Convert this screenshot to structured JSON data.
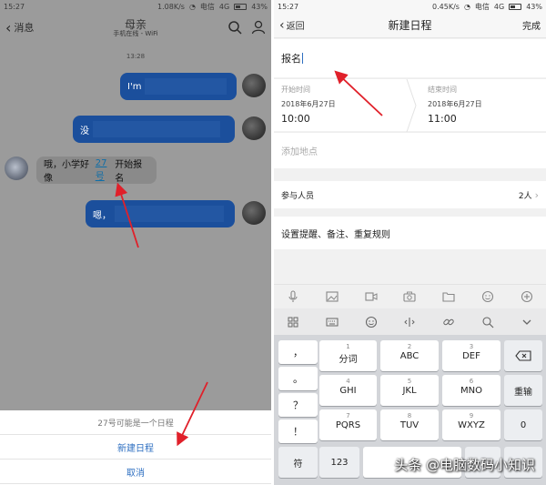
{
  "left": {
    "status": {
      "time": "15:27",
      "network": "1.08K/s",
      "carrier": "电信",
      "net_type": "4G",
      "battery": "43%"
    },
    "header": {
      "back_label": "消息",
      "contact_name": "母亲",
      "contact_sub": "手机在线 - WiFi"
    },
    "timestamp": "13:28",
    "messages": [
      {
        "side": "out",
        "text": "I'm"
      },
      {
        "side": "out",
        "text": "没"
      },
      {
        "side": "in",
        "text_before": "哦，小学好像",
        "link": "27号",
        "text_after": "开始报名"
      },
      {
        "side": "out",
        "text": "嗯，"
      }
    ],
    "action_sheet": {
      "hint": "27号可能是一个日程",
      "create": "新建日程",
      "cancel": "取消"
    }
  },
  "right": {
    "status": {
      "time": "15:27",
      "network": "0.45K/s",
      "carrier": "电信",
      "net_type": "4G",
      "battery": "43%"
    },
    "nav": {
      "back_label": "返回",
      "title": "新建日程",
      "done": "完成"
    },
    "title_value": "报名",
    "start": {
      "label": "开始时间",
      "date": "2018年6月27日",
      "time": "10:00"
    },
    "end": {
      "label": "结束时间",
      "date": "2018年6月27日",
      "time": "11:00"
    },
    "location_placeholder": "添加地点",
    "participants": {
      "label": "参与人员",
      "count": "2人"
    },
    "reminder": "设置提醒、备注、重复规则",
    "keyboard": {
      "row1": [
        {
          "num": "1",
          "let": "分词"
        },
        {
          "num": "2",
          "let": "ABC"
        },
        {
          "num": "3",
          "let": "DEF"
        }
      ],
      "row2": [
        {
          "num": "4",
          "let": "GHI"
        },
        {
          "num": "5",
          "let": "JKL"
        },
        {
          "num": "6",
          "let": "MNO"
        }
      ],
      "row3": [
        {
          "num": "7",
          "let": "PQRS"
        },
        {
          "num": "8",
          "let": "TUV"
        },
        {
          "num": "9",
          "let": "WXYZ"
        }
      ],
      "left_col": [
        "，",
        "。",
        "？",
        "！"
      ],
      "reenter": "重输",
      "zero": "0",
      "symbol": "符",
      "num123": "123"
    }
  },
  "watermark": "头条 @电脑数码小知识",
  "colors": {
    "accent": "#2e6fc1",
    "bubble_out": "#1b4f9c",
    "arrow": "#e0202a"
  }
}
